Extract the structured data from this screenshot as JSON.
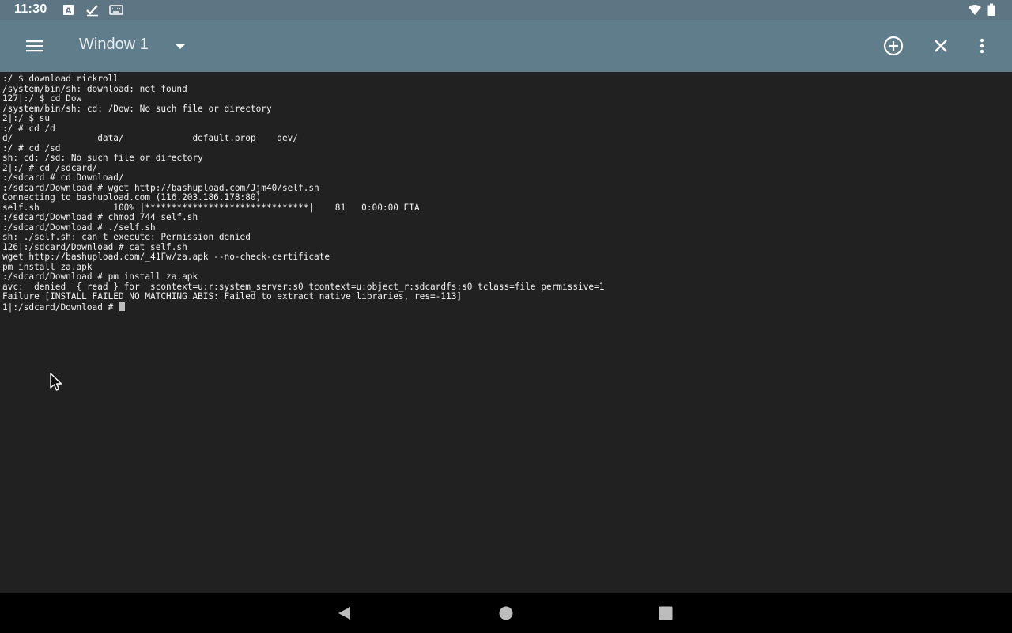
{
  "status_bar": {
    "time": "11:30",
    "icons": [
      "a-icon",
      "check-icon",
      "keyboard-icon",
      "wifi-icon",
      "battery-icon"
    ]
  },
  "app_bar": {
    "title": "Window 1",
    "icons": [
      "menu-icon",
      "dropdown-arrow-icon",
      "add-circle-icon",
      "close-icon",
      "more-vert-icon"
    ]
  },
  "terminal": {
    "lines": [
      ":/ $ download rickroll",
      "/system/bin/sh: download: not found",
      "127|:/ $ cd Dow",
      "/system/bin/sh: cd: /Dow: No such file or directory",
      "2|:/ $ su",
      ":/ # cd /d",
      "d/                data/             default.prop    dev/",
      ":/ # cd /sd",
      "sh: cd: /sd: No such file or directory",
      "2|:/ # cd /sdcard/",
      ":/sdcard # cd Download/",
      ":/sdcard/Download # wget http://bashupload.com/Jjm40/self.sh",
      "Connecting to bashupload.com (116.203.186.178:80)",
      "self.sh              100% |*******************************|    81   0:00:00 ETA",
      ":/sdcard/Download # chmod 744 self.sh",
      ":/sdcard/Download # ./self.sh",
      "sh: ./self.sh: can't execute: Permission denied",
      "126|:/sdcard/Download # cat self.sh",
      "wget http://bashupload.com/_41Fw/za.apk --no-check-certificate",
      "pm install za.apk",
      ":/sdcard/Download # pm install za.apk",
      "avc:  denied  { read } for  scontext=u:r:system_server:s0 tcontext=u:object_r:sdcardfs:s0 tclass=file permissive=1",
      "Failure [INSTALL_FAILED_NO_MATCHING_ABIS: Failed to extract native libraries, res=-113]",
      "1|:/sdcard/Download # "
    ]
  },
  "nav_bar": {
    "icons": [
      "back-icon",
      "home-icon",
      "recents-icon"
    ]
  },
  "colors": {
    "status_bar": "#5e7584",
    "app_bar": "#607d8b",
    "terminal_bg": "#212121",
    "terminal_text": "#f2f2f2",
    "nav_bar": "#000000"
  }
}
